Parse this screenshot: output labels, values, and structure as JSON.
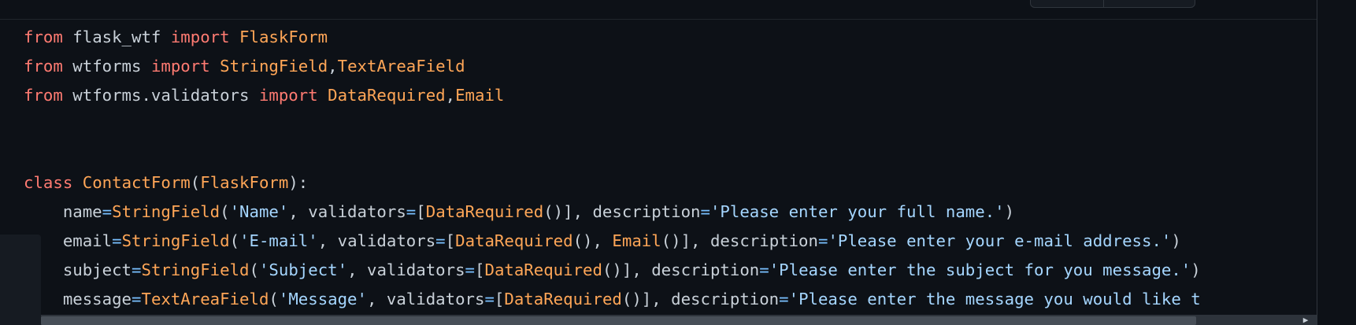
{
  "code_lines": [
    [
      {
        "t": "from",
        "c": "kw"
      },
      {
        "t": " flask_wtf ",
        "c": "plain"
      },
      {
        "t": "import",
        "c": "kw"
      },
      {
        "t": " ",
        "c": "plain"
      },
      {
        "t": "FlaskForm",
        "c": "fn"
      }
    ],
    [
      {
        "t": "from",
        "c": "kw"
      },
      {
        "t": " wtforms ",
        "c": "plain"
      },
      {
        "t": "import",
        "c": "kw"
      },
      {
        "t": " ",
        "c": "plain"
      },
      {
        "t": "StringField",
        "c": "fn"
      },
      {
        "t": ",",
        "c": "plain"
      },
      {
        "t": "TextAreaField",
        "c": "fn"
      }
    ],
    [
      {
        "t": "from",
        "c": "kw"
      },
      {
        "t": " wtforms.validators ",
        "c": "plain"
      },
      {
        "t": "import",
        "c": "kw"
      },
      {
        "t": " ",
        "c": "plain"
      },
      {
        "t": "DataRequired",
        "c": "fn"
      },
      {
        "t": ",",
        "c": "plain"
      },
      {
        "t": "Email",
        "c": "fn"
      }
    ],
    [],
    [],
    [
      {
        "t": "class",
        "c": "kw"
      },
      {
        "t": " ",
        "c": "plain"
      },
      {
        "t": "ContactForm",
        "c": "fn"
      },
      {
        "t": "(",
        "c": "plain"
      },
      {
        "t": "FlaskForm",
        "c": "fn"
      },
      {
        "t": "):",
        "c": "plain"
      }
    ],
    [
      {
        "t": "    name",
        "c": "plain"
      },
      {
        "t": "=",
        "c": "op"
      },
      {
        "t": "StringField",
        "c": "fn"
      },
      {
        "t": "(",
        "c": "plain"
      },
      {
        "t": "'Name'",
        "c": "str"
      },
      {
        "t": ", validators",
        "c": "plain"
      },
      {
        "t": "=",
        "c": "op"
      },
      {
        "t": "[",
        "c": "plain"
      },
      {
        "t": "DataRequired",
        "c": "fn"
      },
      {
        "t": "()], description",
        "c": "plain"
      },
      {
        "t": "=",
        "c": "op"
      },
      {
        "t": "'Please enter your full name.'",
        "c": "str"
      },
      {
        "t": ")",
        "c": "plain"
      }
    ],
    [
      {
        "t": "    email",
        "c": "plain"
      },
      {
        "t": "=",
        "c": "op"
      },
      {
        "t": "StringField",
        "c": "fn"
      },
      {
        "t": "(",
        "c": "plain"
      },
      {
        "t": "'E-mail'",
        "c": "str"
      },
      {
        "t": ", validators",
        "c": "plain"
      },
      {
        "t": "=",
        "c": "op"
      },
      {
        "t": "[",
        "c": "plain"
      },
      {
        "t": "DataRequired",
        "c": "fn"
      },
      {
        "t": "(), ",
        "c": "plain"
      },
      {
        "t": "Email",
        "c": "fn"
      },
      {
        "t": "()], description",
        "c": "plain"
      },
      {
        "t": "=",
        "c": "op"
      },
      {
        "t": "'Please enter your e-mail address.'",
        "c": "str"
      },
      {
        "t": ")",
        "c": "plain"
      }
    ],
    [
      {
        "t": "    subject",
        "c": "plain"
      },
      {
        "t": "=",
        "c": "op"
      },
      {
        "t": "StringField",
        "c": "fn"
      },
      {
        "t": "(",
        "c": "plain"
      },
      {
        "t": "'Subject'",
        "c": "str"
      },
      {
        "t": ", validators",
        "c": "plain"
      },
      {
        "t": "=",
        "c": "op"
      },
      {
        "t": "[",
        "c": "plain"
      },
      {
        "t": "DataRequired",
        "c": "fn"
      },
      {
        "t": "()], description",
        "c": "plain"
      },
      {
        "t": "=",
        "c": "op"
      },
      {
        "t": "'Please enter the subject for you message.'",
        "c": "str"
      },
      {
        "t": ")",
        "c": "plain"
      }
    ],
    [
      {
        "t": "    message",
        "c": "plain"
      },
      {
        "t": "=",
        "c": "op"
      },
      {
        "t": "TextAreaField",
        "c": "fn"
      },
      {
        "t": "(",
        "c": "plain"
      },
      {
        "t": "'Message'",
        "c": "str"
      },
      {
        "t": ", validators",
        "c": "plain"
      },
      {
        "t": "=",
        "c": "op"
      },
      {
        "t": "[",
        "c": "plain"
      },
      {
        "t": "DataRequired",
        "c": "fn"
      },
      {
        "t": "()], description",
        "c": "plain"
      },
      {
        "t": "=",
        "c": "op"
      },
      {
        "t": "'Please enter the message you would like t",
        "c": "str"
      }
    ]
  ],
  "scroll_arrow_icon": "▶"
}
